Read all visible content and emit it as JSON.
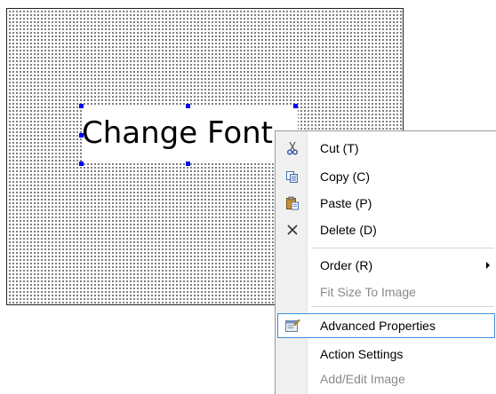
{
  "canvas": {
    "text_object": {
      "label": "Change Font"
    }
  },
  "context_menu": {
    "items": [
      {
        "label": "Cut (T)",
        "icon": "scissors-icon",
        "enabled": true
      },
      {
        "label": "Copy (C)",
        "icon": "copy-icon",
        "enabled": true
      },
      {
        "label": "Paste (P)",
        "icon": "paste-icon",
        "enabled": true
      },
      {
        "label": "Delete (D)",
        "icon": "delete-x-icon",
        "enabled": true
      },
      {
        "label": "Order (R)",
        "icon": "",
        "enabled": true,
        "has_submenu": true
      },
      {
        "label": "Fit Size To Image",
        "icon": "",
        "enabled": false
      },
      {
        "label": "Advanced Properties",
        "icon": "properties-icon",
        "enabled": true,
        "highlighted": true
      },
      {
        "label": "Action Settings",
        "icon": "",
        "enabled": true
      },
      {
        "label": "Add/Edit Image",
        "icon": "",
        "enabled": false
      }
    ]
  },
  "colors": {
    "selection_handle": "#0000ff",
    "menu_highlight_border": "#3e8fd8",
    "disabled_text": "#8a8a8a"
  }
}
